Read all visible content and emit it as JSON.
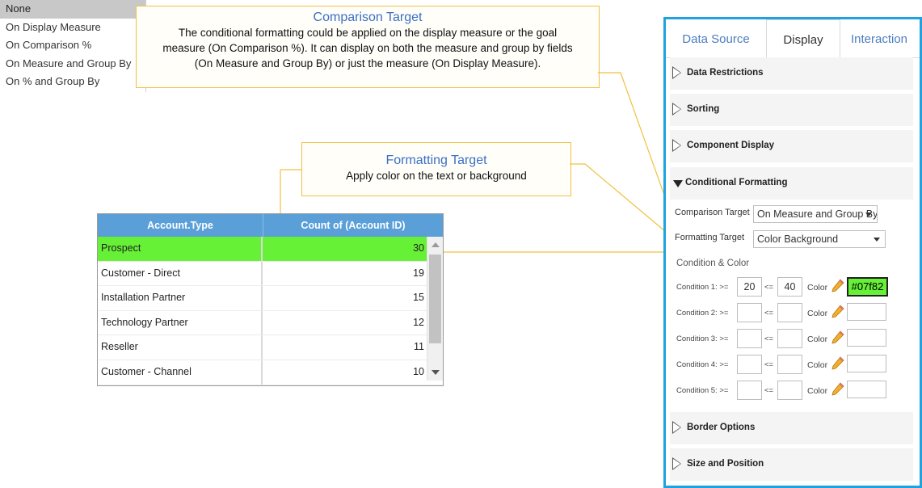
{
  "dropdown": {
    "items": [
      "None",
      "On Display Measure",
      "On Comparison %",
      "On Measure and Group By",
      "On % and Group By"
    ],
    "selected_index": 0
  },
  "callouts": {
    "comparison": {
      "title": "Comparison Target",
      "lines": [
        "The conditional formatting could be applied on the display measure or the goal",
        "measure (On Comparison %). It can display on both the measure and group by fields",
        "(On Measure and Group  By) or just the measure (On Display Measure)."
      ]
    },
    "formatting": {
      "title": "Formatting Target",
      "text": "Apply color on the text or background"
    }
  },
  "table": {
    "headers": [
      "Account.Type",
      "Count of (Account ID)"
    ],
    "rows": [
      {
        "type": "Prospect",
        "count": "30",
        "highlight": true
      },
      {
        "type": "Customer - Direct",
        "count": "19",
        "highlight": false
      },
      {
        "type": "Installation Partner",
        "count": "15",
        "highlight": false
      },
      {
        "type": "Technology Partner",
        "count": "12",
        "highlight": false
      },
      {
        "type": "Reseller",
        "count": "11",
        "highlight": false
      },
      {
        "type": "Customer - Channel",
        "count": "10",
        "highlight": false
      }
    ],
    "highlight_color": "#66f036"
  },
  "panel": {
    "tabs": [
      "Data Source",
      "Display",
      "Interaction"
    ],
    "active_tab": "Display",
    "sections": {
      "data_restrictions": "Data Restrictions",
      "sorting": "Sorting",
      "component_display": "Component Display",
      "conditional_formatting": "Conditional Formatting",
      "border_options": "Border Options",
      "size_position": "Size and Position"
    },
    "comparison_target": {
      "label": "Comparison Target",
      "value": "On Measure and Group By"
    },
    "formatting_target": {
      "label": "Formatting Target",
      "value": "Color Background"
    },
    "condition_title": "Condition & Color",
    "le_symbol": "<=",
    "color_label": "Color",
    "conditions": [
      {
        "label": "Condition 1: >=",
        "min": "20",
        "max": "40",
        "color": "#07f82"
      },
      {
        "label": "Condition 2: >=",
        "min": "",
        "max": "",
        "color": ""
      },
      {
        "label": "Condition 3: >=",
        "min": "",
        "max": "",
        "color": ""
      },
      {
        "label": "Condition 4: >=",
        "min": "",
        "max": "",
        "color": ""
      },
      {
        "label": "Condition 5: >=",
        "min": "",
        "max": "",
        "color": ""
      }
    ],
    "accent_color": "#1fa3e0"
  }
}
